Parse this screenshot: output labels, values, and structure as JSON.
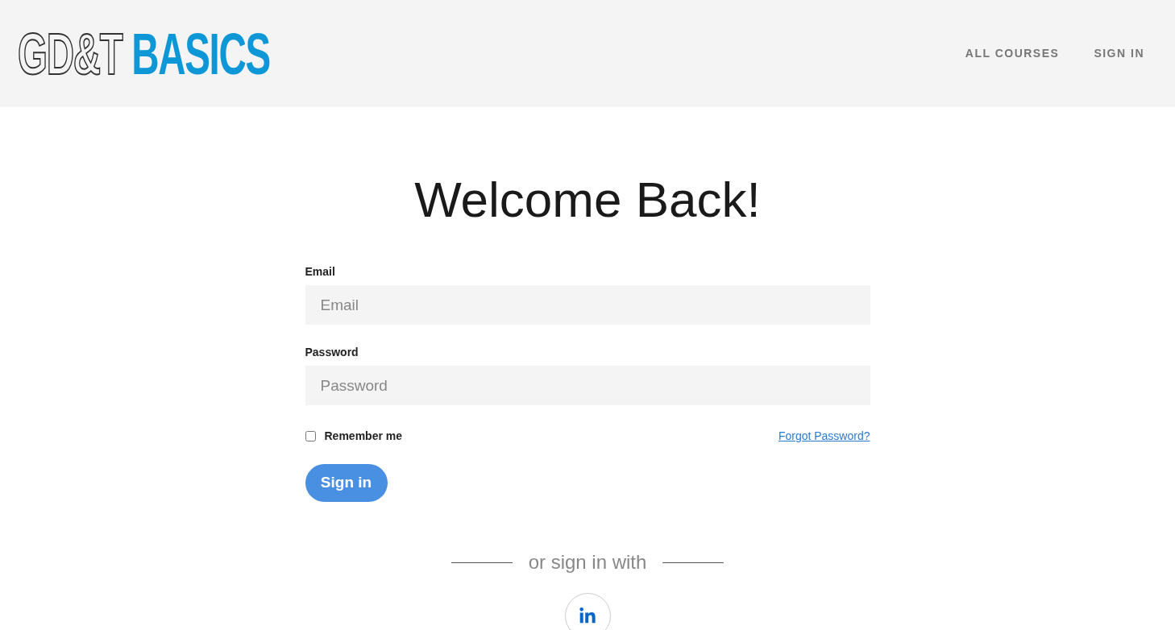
{
  "header": {
    "logo": {
      "outline_text": "GD&T",
      "solid_text": "BASICS"
    },
    "nav": [
      {
        "label": "ALL COURSES"
      },
      {
        "label": "SIGN IN"
      }
    ]
  },
  "heading": "Welcome Back!",
  "form": {
    "fields": [
      {
        "label": "Email",
        "placeholder": "Email"
      },
      {
        "label": "Password",
        "placeholder": "Password"
      }
    ],
    "remember": {
      "label": "Remember me",
      "checked": false
    },
    "forgot_link": "Forgot Password?",
    "submit": "Sign in"
  },
  "alt_sign_in": {
    "label": "or sign in with"
  }
}
